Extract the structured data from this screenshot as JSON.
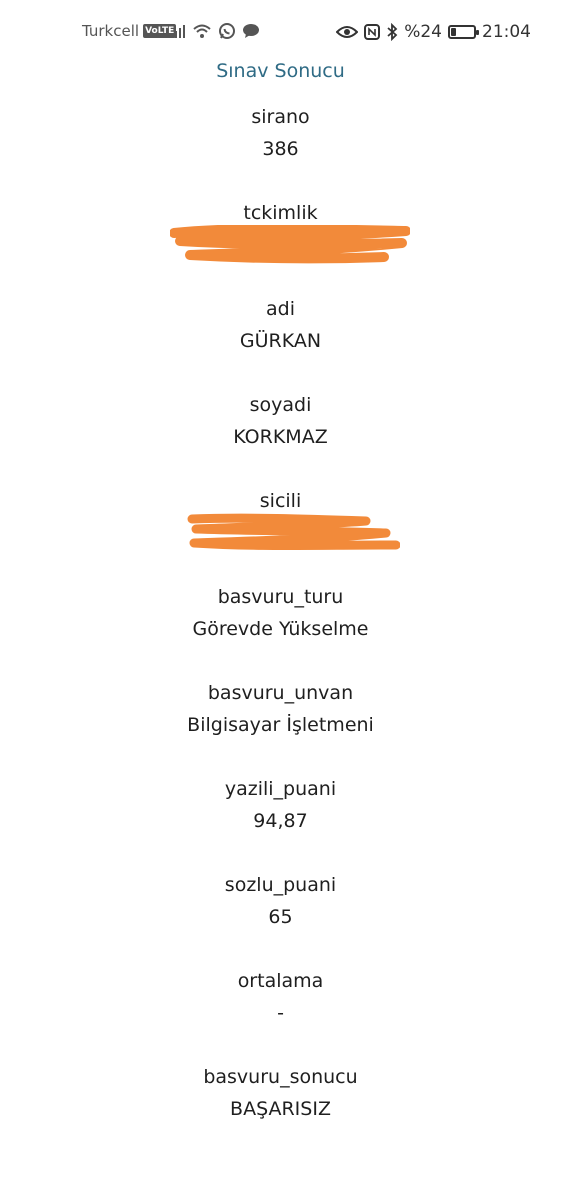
{
  "status_bar": {
    "carrier": "Turkcell",
    "volte": "VoLTE",
    "battery_percent": "%24",
    "time": "21:04",
    "battery_level": 0.24,
    "icons": [
      "signal-icon",
      "wifi-icon",
      "whatsapp-icon",
      "message-icon",
      "eye-icon",
      "nfc-icon",
      "bluetooth-icon",
      "battery-icon"
    ]
  },
  "page": {
    "title": "Sınav Sonucu"
  },
  "fields": {
    "sirano": {
      "label": "sirano",
      "value": "386"
    },
    "tckimlik": {
      "label": "tckimlik",
      "value": ""
    },
    "adi": {
      "label": "adi",
      "value": "GÜRKAN"
    },
    "soyadi": {
      "label": "soyadi",
      "value": "KORKMAZ"
    },
    "sicili": {
      "label": "sicili",
      "value": ""
    },
    "basvuru_turu": {
      "label": "basvuru_turu",
      "value": "Görevde Yükselme"
    },
    "basvuru_unvan": {
      "label": "basvuru_unvan",
      "value": "Bilgisayar İşletmeni"
    },
    "yazili_puani": {
      "label": "yazili_puani",
      "value": "94,87"
    },
    "sozlu_puani": {
      "label": "sozlu_puani",
      "value": "65"
    },
    "ortalama": {
      "label": "ortalama",
      "value": "-"
    },
    "basvuru_sonucu": {
      "label": "basvuru_sonucu",
      "value": "BAŞARISIZ"
    }
  },
  "colors": {
    "title": "#2f6b85",
    "redaction": "#f28a3a",
    "text": "#1f1f1f"
  }
}
